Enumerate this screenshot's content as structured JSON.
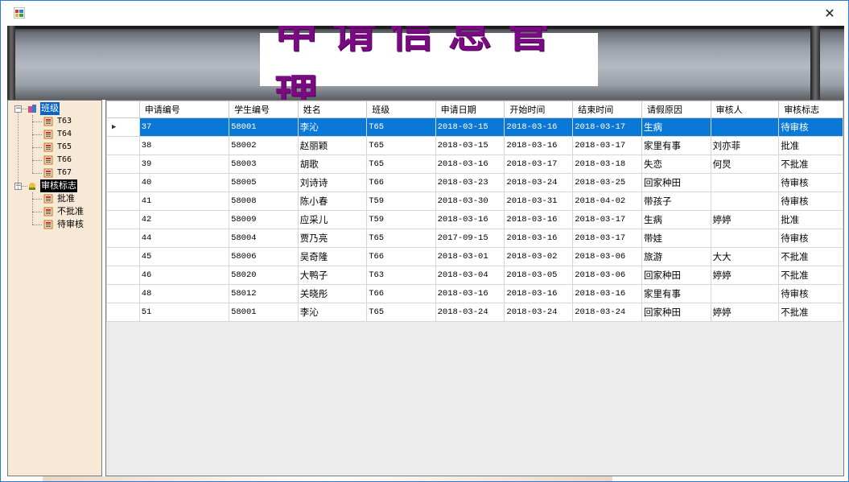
{
  "window": {
    "close_glyph": "✕"
  },
  "banner": {
    "title": "申请信息管理"
  },
  "tree": {
    "nodes": [
      {
        "label": "班级",
        "icon": "class-icon",
        "children": [
          "T63",
          "T64",
          "T65",
          "T66",
          "T67"
        ]
      },
      {
        "label": "审核标志",
        "icon": "audit-icon",
        "children": [
          "批准",
          "不批准",
          "待审核"
        ]
      }
    ],
    "expander_glyph": "−"
  },
  "grid": {
    "columns": [
      "申请编号",
      "学生编号",
      "姓名",
      "班级",
      "申请日期",
      "开始时间",
      "结束时间",
      "请假原因",
      "审核人",
      "审核标志"
    ],
    "selected_row_marker": "▶",
    "rows": [
      [
        "37",
        "58001",
        "李沁",
        "T65",
        "2018-03-15",
        "2018-03-16",
        "2018-03-17",
        "生病",
        "",
        "待审核"
      ],
      [
        "38",
        "58002",
        "赵丽颖",
        "T65",
        "2018-03-15",
        "2018-03-16",
        "2018-03-17",
        "家里有事",
        "刘亦菲",
        "批准"
      ],
      [
        "39",
        "58003",
        "胡歌",
        "T65",
        "2018-03-16",
        "2018-03-17",
        "2018-03-18",
        "失恋",
        "何炅",
        "不批准"
      ],
      [
        "40",
        "58005",
        "刘诗诗",
        "T66",
        "2018-03-23",
        "2018-03-24",
        "2018-03-25",
        "回家种田",
        "",
        "待审核"
      ],
      [
        "41",
        "58008",
        "陈小春",
        "T59",
        "2018-03-30",
        "2018-03-31",
        "2018-04-02",
        "带孩子",
        "",
        "待审核"
      ],
      [
        "42",
        "58009",
        "应采儿",
        "T59",
        "2018-03-16",
        "2018-03-16",
        "2018-03-17",
        "生病",
        "婷婷",
        "批准"
      ],
      [
        "44",
        "58004",
        "贾乃亮",
        "T65",
        "2017-09-15",
        "2018-03-16",
        "2018-03-17",
        "带娃",
        "",
        "待审核"
      ],
      [
        "45",
        "58006",
        "吴奇隆",
        "T66",
        "2018-03-01",
        "2018-03-02",
        "2018-03-06",
        "旅游",
        "大大",
        "不批准"
      ],
      [
        "46",
        "58020",
        "大鸭子",
        "T63",
        "2018-03-04",
        "2018-03-05",
        "2018-03-06",
        "回家种田",
        "婷婷",
        "不批准"
      ],
      [
        "48",
        "58012",
        "关晓彤",
        "T66",
        "2018-03-16",
        "2018-03-16",
        "2018-03-16",
        "家里有事",
        "",
        "待审核"
      ],
      [
        "51",
        "58001",
        "李沁",
        "T65",
        "2018-03-24",
        "2018-03-24",
        "2018-03-24",
        "回家种田",
        "婷婷",
        "不批准"
      ]
    ],
    "text_columns": [
      2,
      7,
      8,
      9
    ]
  },
  "colors": {
    "selection": "#0a78d7",
    "title_purple": "#7a0a82",
    "tree_bg": "#f8e9d6"
  }
}
